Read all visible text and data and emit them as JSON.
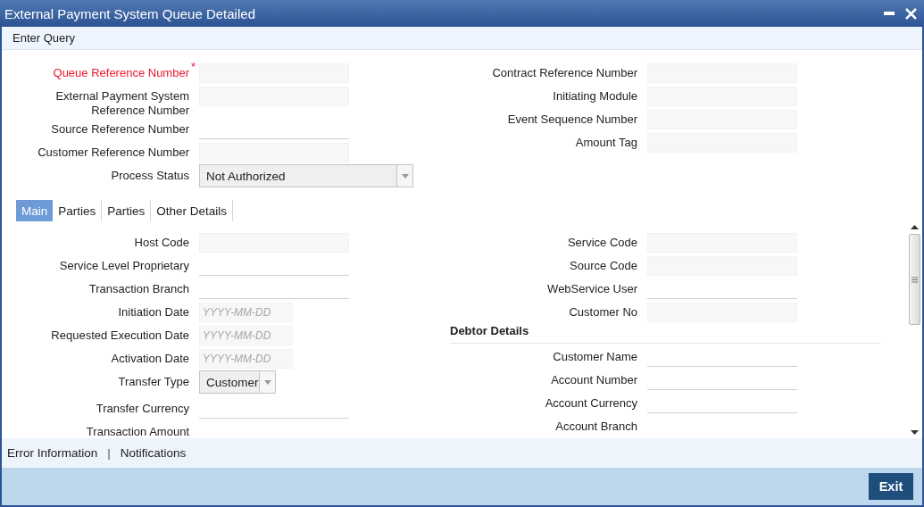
{
  "window": {
    "title": "External Payment System Queue Detailed"
  },
  "menu": [
    "Enter Query"
  ],
  "required_mark": "*",
  "header": {
    "left": [
      {
        "label": "Queue Reference Number",
        "kind": "readonly",
        "required": true
      },
      {
        "label": "External Payment System Reference Number",
        "kind": "readonly",
        "required": false
      },
      {
        "label": "Source Reference Number",
        "kind": "underline",
        "required": false
      },
      {
        "label": "Customer Reference Number",
        "kind": "readonly",
        "required": false
      },
      {
        "label": "Process Status",
        "kind": "select",
        "wide": true,
        "value": "Not Authorized",
        "required": false
      }
    ],
    "right": [
      {
        "label": "Contract Reference Number",
        "kind": "readonly",
        "required": false
      },
      {
        "label": "Initiating Module",
        "kind": "readonly",
        "required": false
      },
      {
        "label": "Event Sequence Number",
        "kind": "readonly",
        "required": false
      },
      {
        "label": "Amount Tag",
        "kind": "readonly",
        "required": false
      }
    ]
  },
  "tabs": [
    {
      "label": "Main",
      "selected": true
    },
    {
      "label": "Parties",
      "selected": false
    },
    {
      "label": "Parties",
      "selected": false
    },
    {
      "label": "Other Details",
      "selected": false
    }
  ],
  "main": {
    "left": [
      {
        "label": "Host Code",
        "kind": "readonly"
      },
      {
        "label": "Service Level Proprietary",
        "kind": "underline"
      },
      {
        "label": "Transaction Branch",
        "kind": "underline"
      },
      {
        "label": "Initiation Date",
        "kind": "date",
        "placeholder": "YYYY-MM-DD"
      },
      {
        "label": "Requested Execution Date",
        "kind": "date",
        "placeholder": "YYYY-MM-DD"
      },
      {
        "label": "Activation Date",
        "kind": "date",
        "placeholder": "YYYY-MM-DD"
      },
      {
        "label": "Transfer Type",
        "kind": "select",
        "wide": false,
        "value": "Customer"
      },
      {
        "label": "Transfer Currency",
        "kind": "underline"
      },
      {
        "label": "Transaction Amount",
        "kind": "label"
      }
    ],
    "right": [
      {
        "label": "Service Code",
        "kind": "readonly"
      },
      {
        "label": "Source Code",
        "kind": "readonly"
      },
      {
        "label": "WebService User",
        "kind": "underline"
      },
      {
        "label": "Customer No",
        "kind": "readonly"
      },
      {
        "label": "Debtor Details",
        "kind": "heading"
      },
      {
        "label": "Customer Name",
        "kind": "underline"
      },
      {
        "label": "Account Number",
        "kind": "underline"
      },
      {
        "label": "Account Currency",
        "kind": "underline"
      },
      {
        "label": "Account Branch",
        "kind": "label"
      }
    ]
  },
  "footer_links": [
    {
      "label": "Error Information",
      "kind": "link"
    },
    {
      "label": "|",
      "kind": "separator"
    },
    {
      "label": "Notifications",
      "kind": "link"
    }
  ],
  "buttons": [
    "Exit"
  ]
}
